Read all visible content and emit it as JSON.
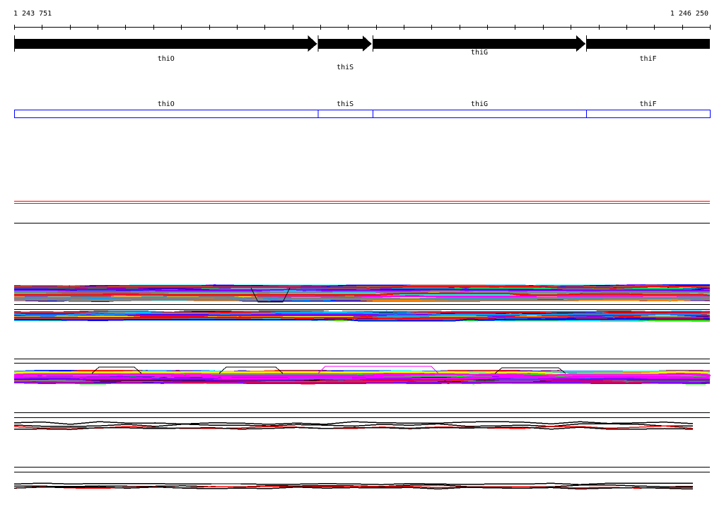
{
  "ruler": {
    "start_label": "1 243 751",
    "end_label": "1 246 250",
    "start": 1243751,
    "end": 1246250
  },
  "genes": [
    {
      "name": "thiO",
      "start": 1243751,
      "end": 1244842
    },
    {
      "name": "thiS",
      "start": 1244842,
      "end": 1245038
    },
    {
      "name": "thiG",
      "start": 1245038,
      "end": 1245806
    },
    {
      "name": "thiF",
      "start": 1245806,
      "end": 1246250
    }
  ],
  "colors": {
    "gene_arrow": "#000000",
    "gene_box": "#0000ff",
    "track_accent": "#ff0000",
    "palette": [
      "#ff00ff",
      "#00ffff",
      "#ff0000",
      "#00ff00",
      "#0000ff",
      "#ff8000",
      "#808080",
      "#a05050",
      "#ffff00",
      "#000000",
      "#8000ff",
      "#00a0ff"
    ]
  }
}
